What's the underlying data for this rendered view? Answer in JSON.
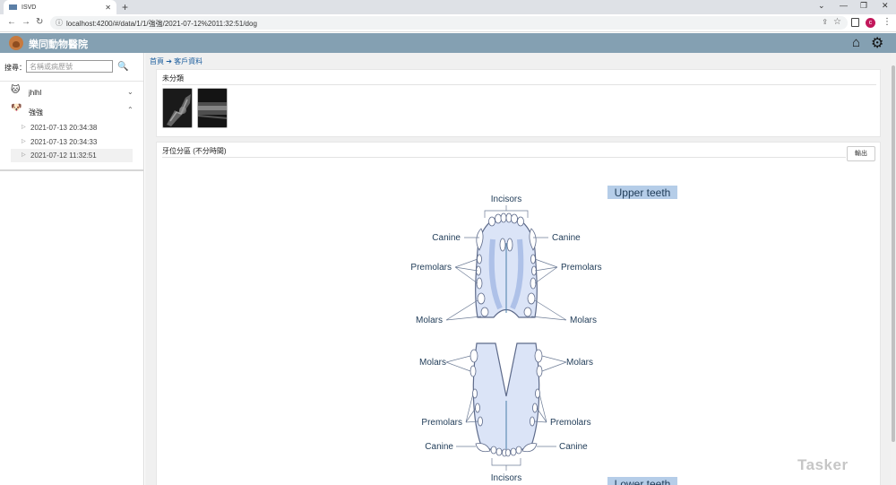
{
  "browser": {
    "tab_title": "ISVD",
    "tab_close": "✕",
    "new_tab": "+",
    "url": "localhost:4200/#/data/1/1/強強/2021-07-12%2011:32:51/dog",
    "profile_initial": "c",
    "window_controls": [
      "⌄",
      "—",
      "❐",
      "✕"
    ]
  },
  "app": {
    "title": "樂同動物醫院"
  },
  "sidebar": {
    "search_label": "搜尋：",
    "search_placeholder": "名稱或病歷號",
    "search_value": "",
    "pets": [
      {
        "name": "jhlhl",
        "avatar": "🐱",
        "expanded": false,
        "chevron": "⌄"
      },
      {
        "name": "強強",
        "avatar": "🐶",
        "expanded": true,
        "chevron": "⌃"
      }
    ],
    "visits": [
      "2021-07-13 20:34:38",
      "2021-07-13 20:34:33",
      "2021-07-12 11:32:51"
    ],
    "selected_visit": "2021-07-12 11:32:51"
  },
  "main": {
    "breadcrumb": "首頁 ➔ 客戶資料",
    "uncategorized_title": "未分類",
    "section_title": "牙位分區 (不分時間)",
    "export_label": "輸出"
  },
  "diagram": {
    "upper_title": "Upper teeth",
    "lower_title": "Lower teeth",
    "labels": {
      "incisors": "Incisors",
      "canine": "Canine",
      "premolars": "Premolars",
      "molars": "Molars"
    }
  },
  "watermark": "Tasker",
  "colors": {
    "header": "#84a0b2",
    "link": "#1e5f9e",
    "diagram_fill": "#dbe4f7",
    "diagram_stroke": "#5d6a8a",
    "title_highlight": "#b5cde8"
  }
}
